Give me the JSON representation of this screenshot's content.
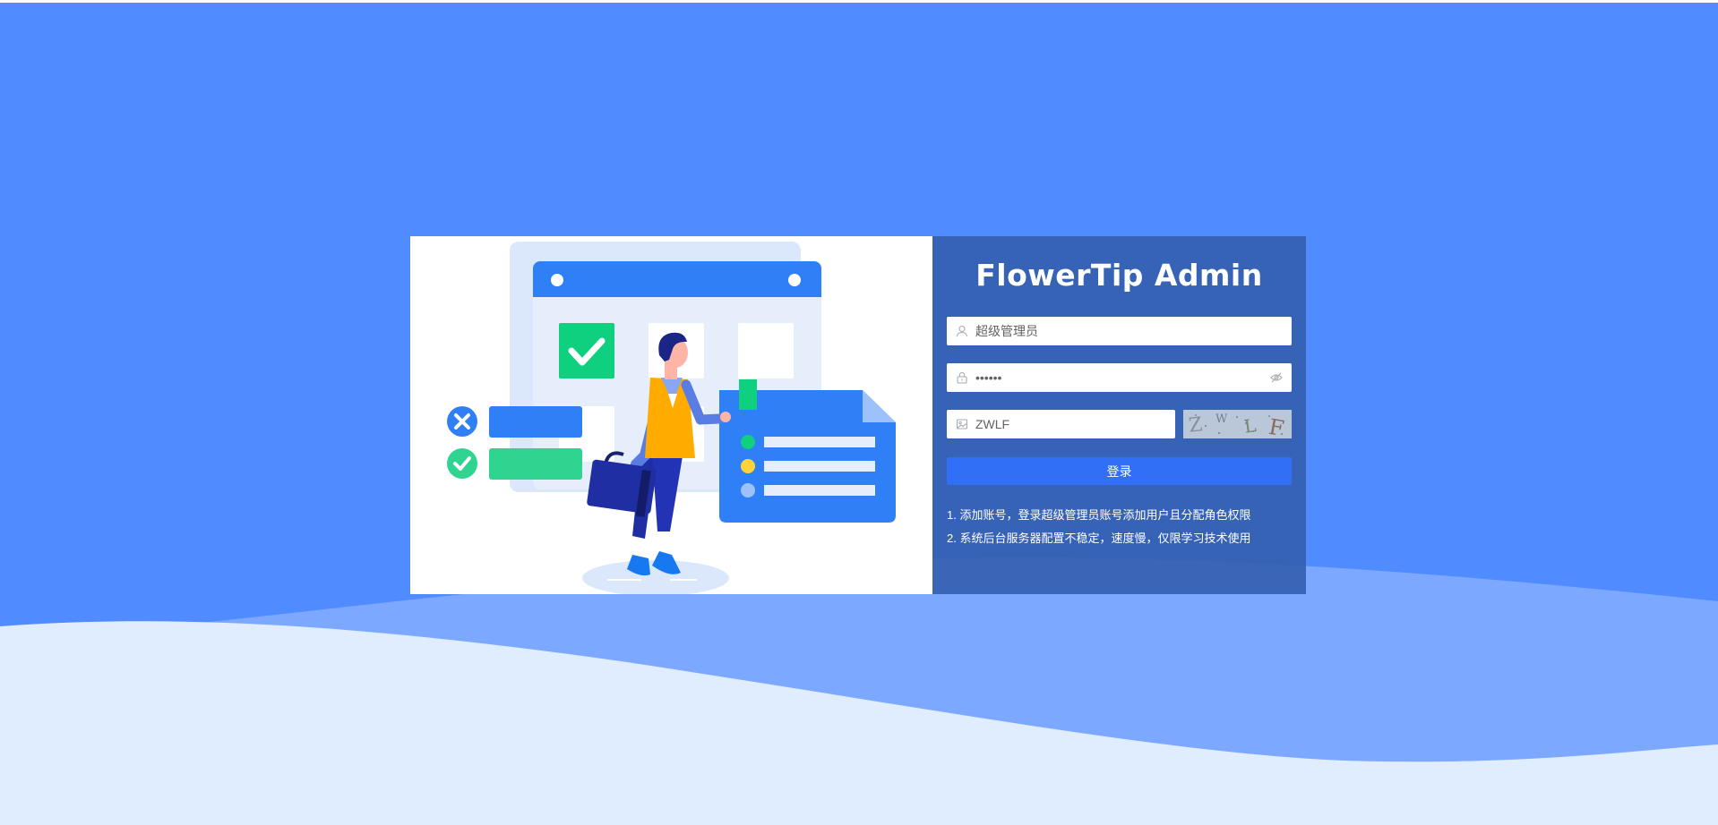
{
  "app": {
    "title": "FlowerTip Admin"
  },
  "login": {
    "username_value": "超级管理员",
    "username_icon": "user-icon",
    "password_value": "••••••",
    "password_icon": "lock-icon",
    "password_toggle_icon": "eye-hidden-icon",
    "captcha_value": "ZWLF",
    "captcha_icon": "picture-icon",
    "captcha_image_text": "ZWLF",
    "submit_label": "登录"
  },
  "tips": [
    "1. 添加账号，登录超级管理员账号添加用户且分配角色权限",
    "2. 系统后台服务器配置不稳定，速度慢，仅限学习技术使用"
  ],
  "colors": {
    "background": "#508bff",
    "panel": "#355fb1",
    "button": "#3170f6",
    "wave_light": "#e0edff",
    "wave_mid": "#7ca8ff"
  }
}
